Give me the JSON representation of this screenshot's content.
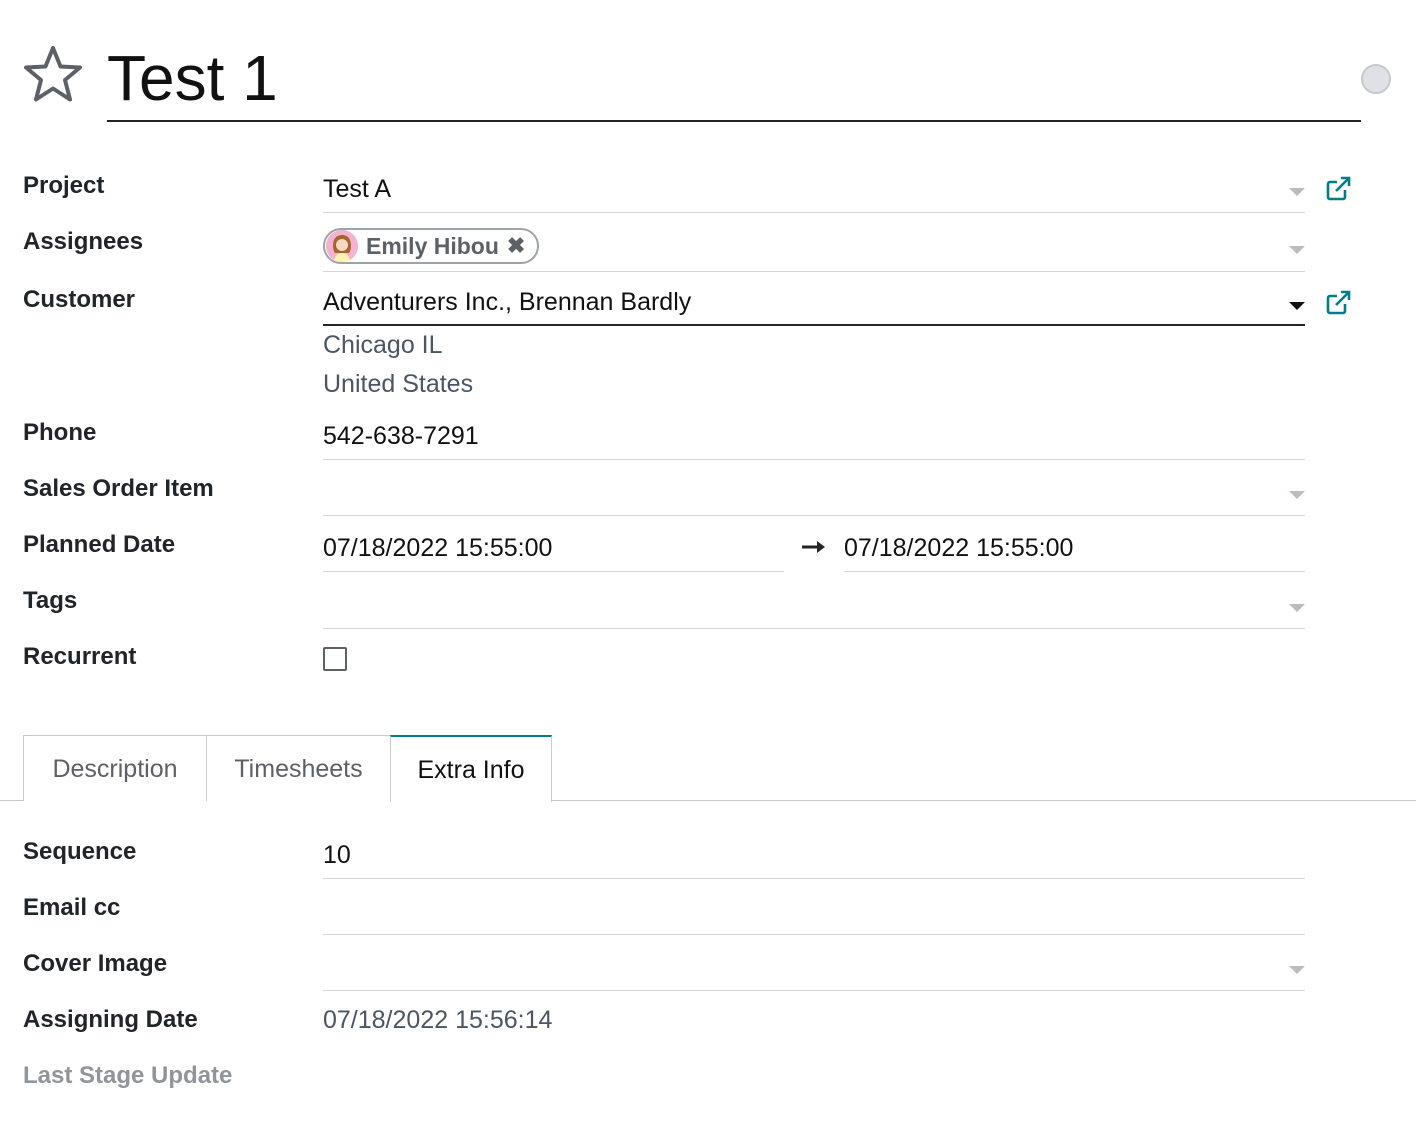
{
  "header": {
    "title": "Test 1",
    "favorite_icon": "star-outline-icon",
    "status_color": "#dee2e6"
  },
  "fields": {
    "project": {
      "label": "Project",
      "value": "Test A"
    },
    "assignees": {
      "label": "Assignees",
      "tags": [
        "Emily Hibou"
      ]
    },
    "customer": {
      "label": "Customer",
      "value": "Adventurers Inc., Brennan Bardly",
      "address_line1": "Chicago IL",
      "address_line2": "United States"
    },
    "phone": {
      "label": "Phone",
      "value": "542-638-7291"
    },
    "sales_order_item": {
      "label": "Sales Order Item",
      "value": ""
    },
    "planned_date": {
      "label": "Planned Date",
      "start": "07/18/2022 15:55:00",
      "end": "07/18/2022 15:55:00"
    },
    "tags": {
      "label": "Tags",
      "value": ""
    },
    "recurrent": {
      "label": "Recurrent",
      "checked": false
    }
  },
  "tabs": [
    {
      "label": "Description",
      "active": false
    },
    {
      "label": "Timesheets",
      "active": false
    },
    {
      "label": "Extra Info",
      "active": true
    }
  ],
  "extra_info": {
    "sequence": {
      "label": "Sequence",
      "value": "10"
    },
    "email_cc": {
      "label": "Email cc",
      "value": ""
    },
    "cover_image": {
      "label": "Cover Image",
      "value": ""
    },
    "assigning_date": {
      "label": "Assigning Date",
      "value": "07/18/2022 15:56:14"
    },
    "last_stage_update": {
      "label": "Last Stage Update",
      "value": ""
    }
  },
  "colors": {
    "accent": "#017e84",
    "text": "#212529",
    "muted": "#8f959b"
  }
}
